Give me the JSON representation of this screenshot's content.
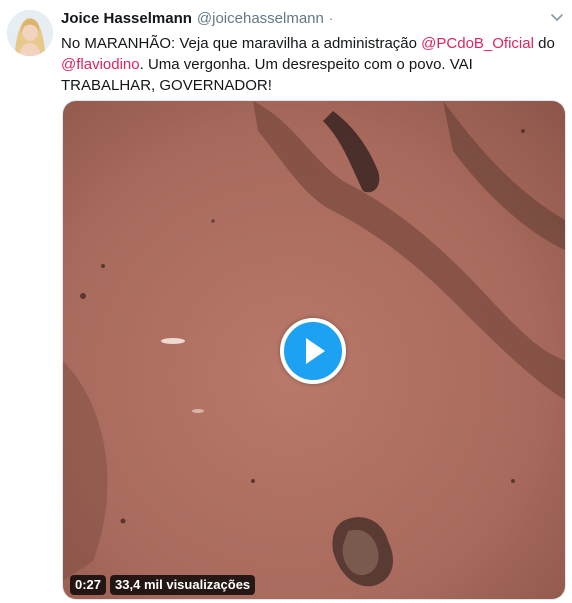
{
  "tweet": {
    "author_name": "Joice Hasselmann",
    "author_handle": "@joicehasselmann",
    "separator": "·",
    "text_part1": "No MARANHÃO: Veja que maravilha a administração ",
    "mention1": "@PCdoB_Oficial",
    "text_part2": " do ",
    "mention2": "@flaviodino",
    "text_part3": ". Uma vergonha. Um desrespeito com o povo. VAI TRABALHAR, GOVERNADOR!"
  },
  "video": {
    "duration": "0:27",
    "views": "33,4 mil visualizações",
    "play_icon": "play-icon"
  },
  "icons": {
    "avatar": "avatar",
    "menu": "chevron-down-icon"
  },
  "colors": {
    "mention": "#e0245e",
    "play_button": "#1da1f2",
    "name": "#14171a",
    "handle": "#657786"
  }
}
